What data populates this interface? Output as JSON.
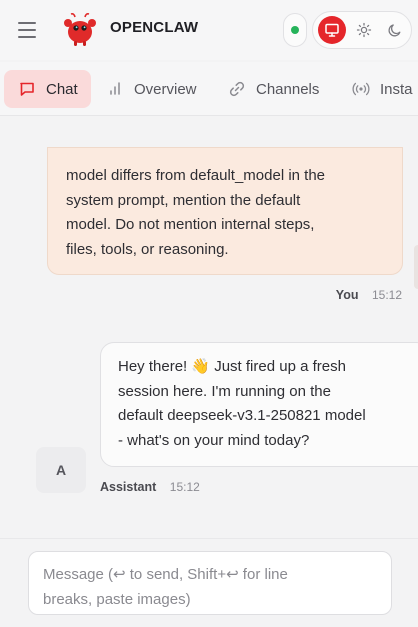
{
  "header": {
    "brand": "OPENCLAW",
    "menu_icon": "hamburger-menu-icon",
    "logo_icon": "red-crab-mascot-icon",
    "status_color": "#26b35a",
    "theme_modes": [
      {
        "name": "system",
        "icon": "monitor-icon",
        "active": true
      },
      {
        "name": "light",
        "icon": "sun-icon",
        "active": false
      },
      {
        "name": "dark",
        "icon": "moon-icon",
        "active": false
      }
    ],
    "accent_color": "#e5262b"
  },
  "tabs": [
    {
      "label": "Chat",
      "icon": "chat-bubble-icon",
      "active": true
    },
    {
      "label": "Overview",
      "icon": "bar-chart-icon",
      "active": false
    },
    {
      "label": "Channels",
      "icon": "link-icon",
      "active": false
    },
    {
      "label": "Insta",
      "icon": "broadcast-icon",
      "active": false
    }
  ],
  "messages": {
    "user": {
      "lines": [
        "model differs from default_model in the",
        "system prompt, mention the default",
        "model. Do not mention internal steps,",
        "files, tools, or reasoning."
      ],
      "sender": "You",
      "time": "15:12"
    },
    "assistant": {
      "lines": [
        "Hey there! 👋 Just fired up a fresh",
        "session here. I'm running on the",
        "default deepseek-v3.1-250821 model",
        "- what's on your mind today?"
      ],
      "sender": "Assistant",
      "time": "15:12",
      "avatar_letter": "A"
    }
  },
  "composer": {
    "line1": "Message (↩ to send, Shift+↩ for line",
    "line2": "breaks, paste images)"
  }
}
